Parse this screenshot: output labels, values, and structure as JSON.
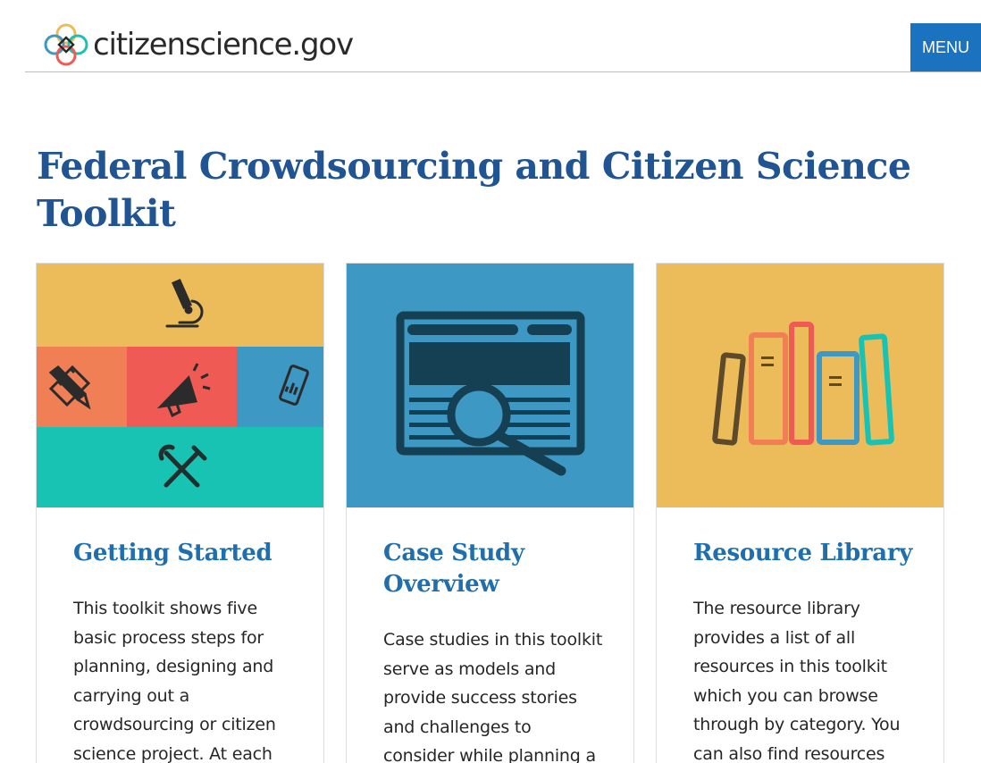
{
  "header": {
    "logo_text": "citizenscience.gov",
    "menu_label": "MENU"
  },
  "page": {
    "title": "Federal Crowdsourcing and Citizen Science Toolkit"
  },
  "cards": [
    {
      "title": "Getting Started",
      "description": "This toolkit shows five basic process steps for planning, designing and carrying out a crowdsourcing or citizen science project. At each",
      "icons": [
        "microscope-icon",
        "pencil-ruler-icon",
        "megaphone-icon",
        "mobile-chart-icon",
        "tools-icon"
      ],
      "colors": {
        "yellow": "#ecbc5b",
        "orange": "#f07f55",
        "red": "#ef5a54",
        "blue": "#3d98c3",
        "teal": "#19c3b4"
      }
    },
    {
      "title": "Case Study Overview",
      "description": "Case studies in this toolkit serve as models and provide success stories and challenges to consider while planning a",
      "icons": [
        "browser-search-icon"
      ],
      "colors": {
        "background": "#3d98c3",
        "icon": "#153f52"
      }
    },
    {
      "title": "Resource Library",
      "description": "The resource library provides a list of all resources in this toolkit which you can browse through by category. You can also find resources",
      "icons": [
        "books-icon"
      ],
      "colors": {
        "background": "#ecbc5b"
      }
    }
  ],
  "colors": {
    "accent": "#1b72be",
    "title": "#205493",
    "card_title": "#1f6fae"
  }
}
